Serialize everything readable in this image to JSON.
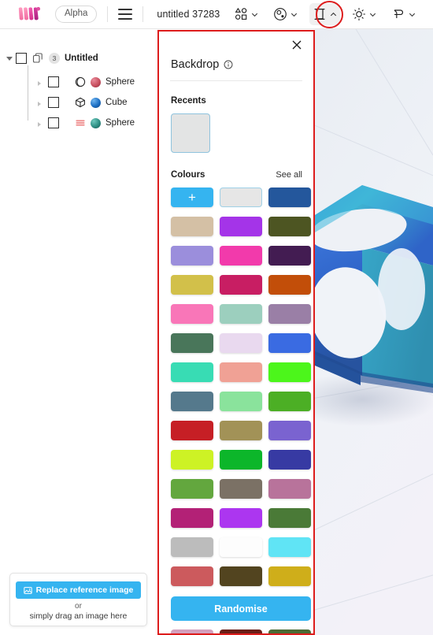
{
  "topbar": {
    "logo_name": "womp-logo",
    "alpha_label": "Alpha",
    "menu_icon": "hamburger-menu-icon",
    "doc_title": "untitled 37283",
    "tools": [
      {
        "icon": "shapes-icon",
        "name": "shapes-tool",
        "has_chevron": true,
        "active": false
      },
      {
        "icon": "material-icon",
        "name": "material-tool",
        "has_chevron": true,
        "active": false
      },
      {
        "icon": "backdrop-icon",
        "name": "backdrop-tool",
        "has_chevron": true,
        "active": true
      },
      {
        "icon": "light-icon",
        "name": "light-tool",
        "has_chevron": true,
        "active": false
      },
      {
        "icon": "effects-icon",
        "name": "effects-tool",
        "has_chevron": true,
        "active": false
      }
    ]
  },
  "outliner": {
    "root": {
      "label": "Untitled",
      "count": "3",
      "checked": false,
      "expanded": true
    },
    "items": [
      {
        "label": "Sphere",
        "shape_icon": "sphere-outline-icon",
        "material_color": "#c8505f",
        "checked": false
      },
      {
        "label": "Cube",
        "shape_icon": "cube-outline-icon",
        "material_color": "#1d6fc4",
        "checked": false
      },
      {
        "label": "Sphere",
        "shape_icon": "stripes-icon",
        "material_color": "#2e8f84",
        "checked": false
      }
    ]
  },
  "reference_card": {
    "button_label": "Replace reference image",
    "button_icon": "image-icon",
    "or_label": "or",
    "drag_label": "simply drag an image here"
  },
  "panel": {
    "close_icon": "close-icon",
    "title": "Backdrop",
    "info_icon": "info-icon",
    "recents_label": "Recents",
    "recent_swatches": [
      "#e3e4e4"
    ],
    "colours_label": "Colours",
    "see_all_label": "See all",
    "add_label": "+",
    "randomise_label": "Randomise",
    "swatches": [
      "#35b4f0",
      "#e6e6e6",
      "#24579c",
      "#d4c0a5",
      "#a434e8",
      "#4d5522",
      "#9b8edc",
      "#f23aab",
      "#431c52",
      "#d2c04a",
      "#c81e63",
      "#c24e09",
      "#f976b8",
      "#9ccfbe",
      "#9a7fa6",
      "#49765a",
      "#e9d9ef",
      "#3a6be2",
      "#38dcb4",
      "#f0a195",
      "#4cf61b",
      "#55798c",
      "#8ae39c",
      "#4caf25",
      "#c61f25",
      "#a29257",
      "#7a63d0",
      "#cdf225",
      "#0cb62a",
      "#373aa3",
      "#63a73e",
      "#7b7165",
      "#b8739b",
      "#b32176",
      "#ac36f0",
      "#4a7a37",
      "#bcbcbc",
      "#fdfdfd",
      "#60e4f5",
      "#cc5a5d",
      "#52441f",
      "#cfae1a"
    ],
    "tail_swatches": [
      "#d4a0bd",
      "#6b1f18",
      "#4c6b35"
    ]
  },
  "viewport": {
    "name": "3d-viewport",
    "object_label": "blue-rounded-cube-object",
    "floor_color": "#eef1f6",
    "object_color_top": "#3aa8d8",
    "object_color_main": "#2f64c8"
  },
  "annotations": {
    "rect_color": "#dd1c1c",
    "circle_color": "#dd1c1c"
  }
}
